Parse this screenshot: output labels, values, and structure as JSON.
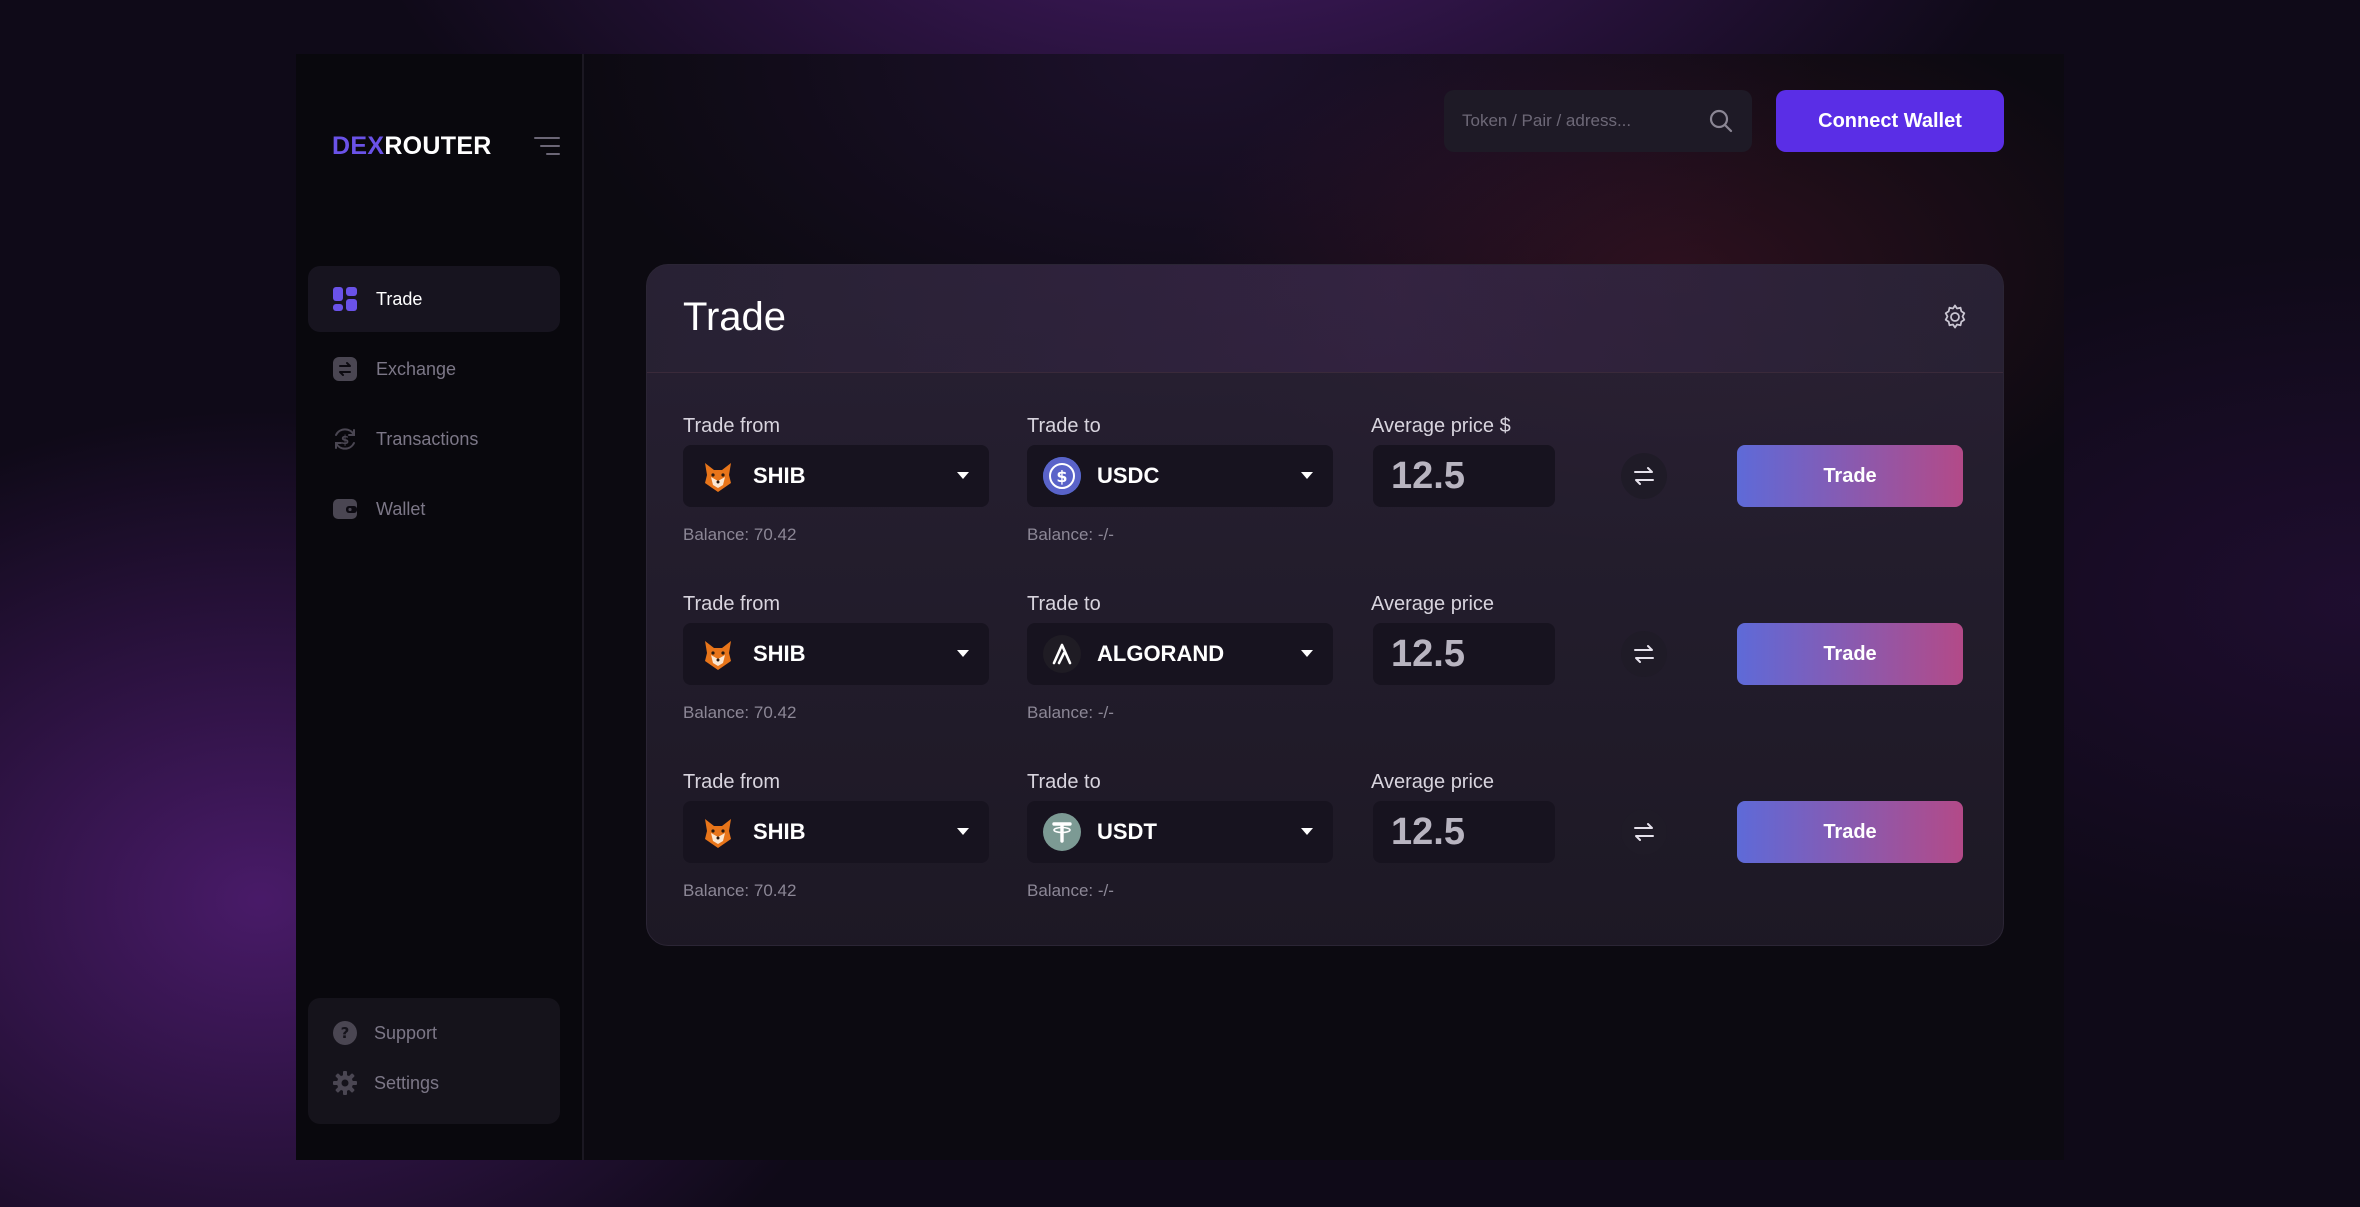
{
  "brand": {
    "part1": "DEX",
    "part2": "ROUTER"
  },
  "nav": [
    {
      "label": "Trade",
      "icon": "grid-icon",
      "active": true
    },
    {
      "label": "Exchange",
      "icon": "exchange-icon",
      "active": false
    },
    {
      "label": "Transactions",
      "icon": "dollar-cycle-icon",
      "active": false
    },
    {
      "label": "Wallet",
      "icon": "wallet-icon",
      "active": false
    }
  ],
  "footer_nav": [
    {
      "label": "Support",
      "icon": "help-icon"
    },
    {
      "label": "Settings",
      "icon": "gear-icon"
    }
  ],
  "search": {
    "placeholder": "Token / Pair / adress..."
  },
  "connect_label": "Connect Wallet",
  "panel": {
    "title": "Trade"
  },
  "rows": [
    {
      "from_label": "Trade from",
      "from_token": "SHIB",
      "from_balance": "Balance: 70.42",
      "to_label": "Trade to",
      "to_token": "USDC",
      "to_balance": "Balance: -/-",
      "price_label": "Average price $",
      "price": "12.5",
      "button": "Trade"
    },
    {
      "from_label": "Trade from",
      "from_token": "SHIB",
      "from_balance": "Balance: 70.42",
      "to_label": "Trade to",
      "to_token": "ALGORAND",
      "to_balance": "Balance: -/-",
      "price_label": "Average price",
      "price": "12.5",
      "button": "Trade"
    },
    {
      "from_label": "Trade from",
      "from_token": "SHIB",
      "from_balance": "Balance: 70.42",
      "to_label": "Trade to",
      "to_token": "USDT",
      "to_balance": "Balance: -/-",
      "price_label": "Average price",
      "price": "12.5",
      "button": "Trade"
    }
  ],
  "colors": {
    "accent": "#5a2ee6",
    "brand_dex": "#6a52e8",
    "trade_gradient_start": "#5e6ad8",
    "trade_gradient_end": "#b34a88"
  }
}
